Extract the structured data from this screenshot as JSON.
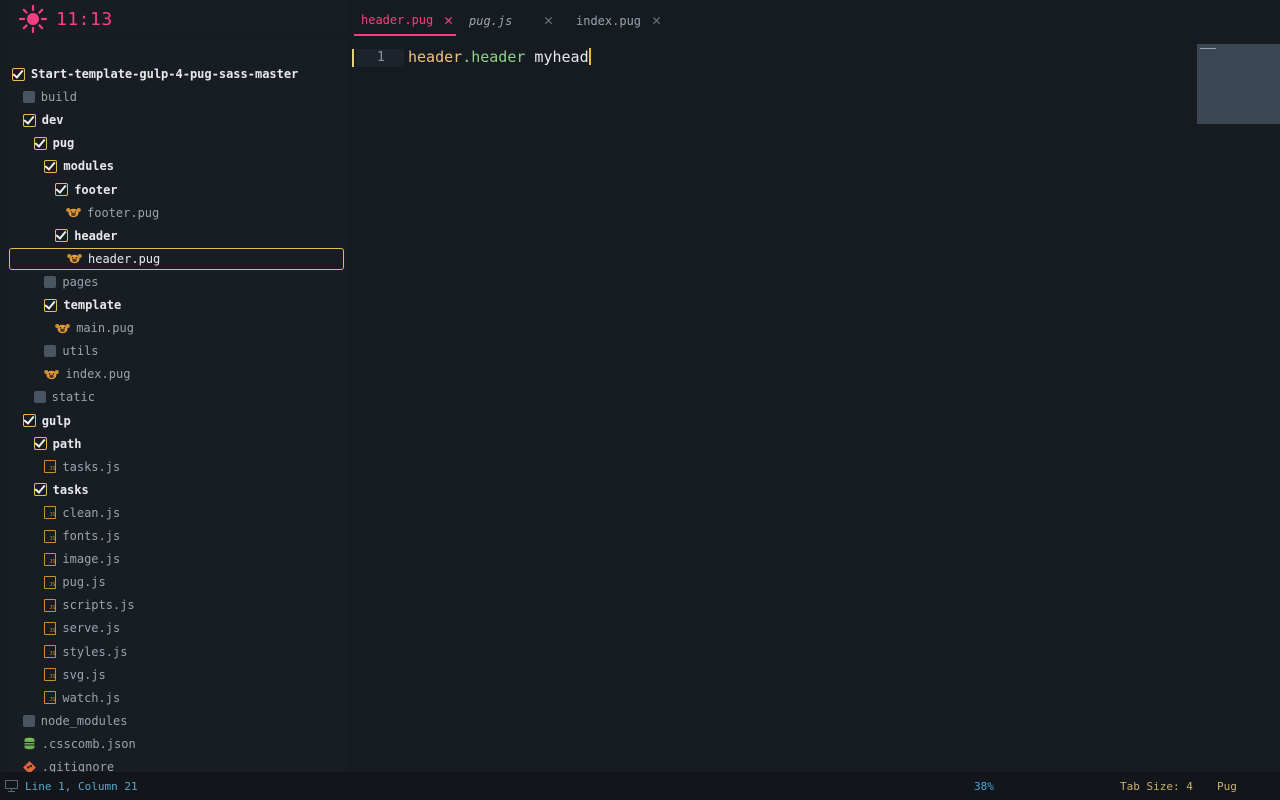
{
  "clock": {
    "time": "11:13",
    "color": "#f4407e"
  },
  "tabs": [
    {
      "label": "header.pug",
      "active": true
    },
    {
      "label": "pug.js",
      "active": false
    },
    {
      "label": "index.pug",
      "active": false
    }
  ],
  "tree": [
    {
      "label": "Start-template-gulp-4-pug-sass-master",
      "type": "folder-open",
      "depth": 0
    },
    {
      "label": "build",
      "type": "folder-closed",
      "depth": 1
    },
    {
      "label": "dev",
      "type": "folder-open",
      "depth": 1
    },
    {
      "label": "pug",
      "type": "folder-open",
      "depth": 2
    },
    {
      "label": "modules",
      "type": "folder-open",
      "depth": 3
    },
    {
      "label": "footer",
      "type": "folder-open",
      "depth": 4
    },
    {
      "label": "footer.pug",
      "type": "pug",
      "depth": 5
    },
    {
      "label": "header",
      "type": "folder-open",
      "depth": 4
    },
    {
      "label": "header.pug",
      "type": "pug",
      "depth": 5,
      "selected": true
    },
    {
      "label": "pages",
      "type": "folder-closed",
      "depth": 3
    },
    {
      "label": "template",
      "type": "folder-open",
      "depth": 3
    },
    {
      "label": "main.pug",
      "type": "pug",
      "depth": 4
    },
    {
      "label": "utils",
      "type": "folder-closed",
      "depth": 3
    },
    {
      "label": "index.pug",
      "type": "pug",
      "depth": 3
    },
    {
      "label": "static",
      "type": "folder-closed",
      "depth": 2
    },
    {
      "label": "gulp",
      "type": "folder-open",
      "depth": 1
    },
    {
      "label": "path",
      "type": "folder-open",
      "depth": 2
    },
    {
      "label": "tasks.js",
      "type": "js",
      "depth": 3
    },
    {
      "label": "tasks",
      "type": "folder-open",
      "depth": 2
    },
    {
      "label": "clean.js",
      "type": "js",
      "depth": 3
    },
    {
      "label": "fonts.js",
      "type": "js",
      "depth": 3
    },
    {
      "label": "image.js",
      "type": "js",
      "depth": 3
    },
    {
      "label": "pug.js",
      "type": "js",
      "depth": 3
    },
    {
      "label": "scripts.js",
      "type": "js",
      "depth": 3
    },
    {
      "label": "serve.js",
      "type": "js",
      "depth": 3
    },
    {
      "label": "styles.js",
      "type": "js",
      "depth": 3
    },
    {
      "label": "svg.js",
      "type": "js",
      "depth": 3
    },
    {
      "label": "watch.js",
      "type": "js",
      "depth": 3
    },
    {
      "label": "node_modules",
      "type": "folder-closed",
      "depth": 1
    },
    {
      "label": ".csscomb.json",
      "type": "json",
      "depth": 1
    },
    {
      "label": ".gitignore",
      "type": "git",
      "depth": 1
    }
  ],
  "editor": {
    "line_number": "1",
    "code": {
      "tag": "header",
      "cls": ".header",
      "text": " myhead"
    }
  },
  "status": {
    "cursor": "Line 1, Column 21",
    "scroll": "38%",
    "tab_size": "Tab Size: 4",
    "syntax": "Pug"
  },
  "colors": {
    "accent": "#f4407e",
    "folder": "#e7bb52",
    "background": "#171c22"
  }
}
